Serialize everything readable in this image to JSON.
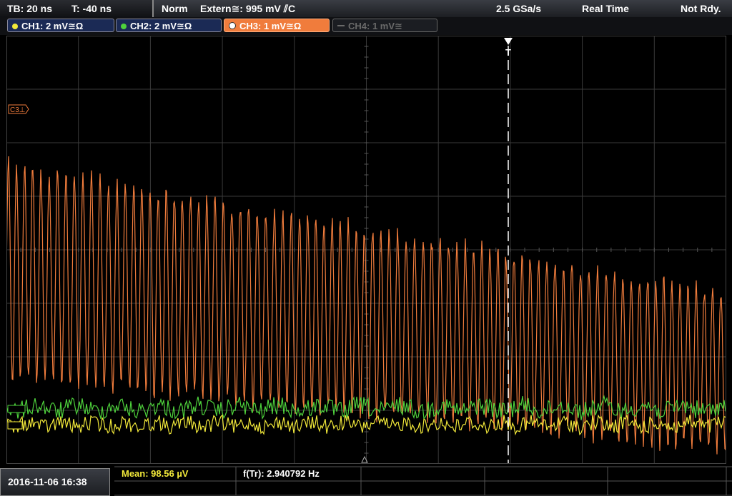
{
  "header": {
    "timebase": "TB: 20 ns",
    "trigger_time": "T: -40 ns",
    "trigger_mode": "Norm",
    "trigger_source": "Extern≅: 995 mV ⫽C",
    "sample_rate": "2.5 GSa/s",
    "acq_mode": "Real Time",
    "status": "Not Rdy."
  },
  "channels": [
    {
      "label": "CH1: 2 mV≅Ω",
      "color": "#f2e93a"
    },
    {
      "label": "CH2: 2 mV≅Ω",
      "color": "#4ed23c"
    },
    {
      "label": "CH3: 1 mV≅Ω",
      "color": "#f07c3c"
    },
    {
      "label": "CH4: 1 mV≅",
      "color": "#7a7a7a"
    }
  ],
  "markers": {
    "c3_label": "C3⊥",
    "trigger_marker": "T"
  },
  "footer": {
    "datetime": "2016-11-06 16:38",
    "mean": "Mean: 98.56 µV",
    "freq": "f(Tr): 2.940792 Hz"
  },
  "colors": {
    "ch1": "#f2e93a",
    "ch2": "#4ed23c",
    "ch3": "#f07c3c",
    "grid": "#3a3a3a"
  }
}
